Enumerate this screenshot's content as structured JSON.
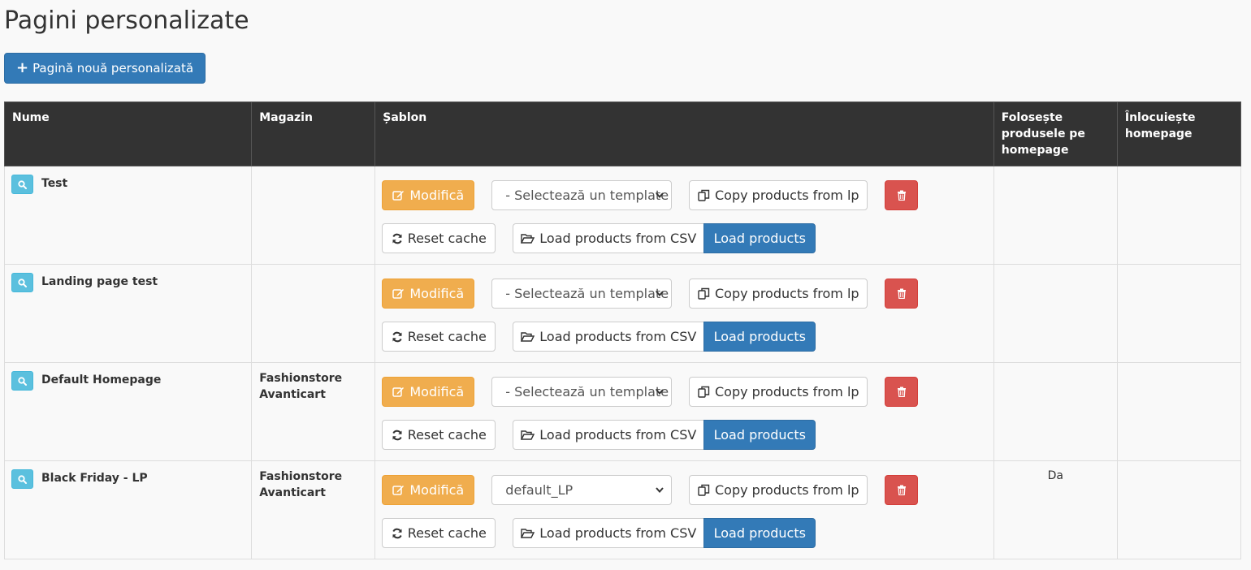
{
  "page": {
    "title": "Pagini personalizate",
    "new_button_label": "Pagină nouă personalizată"
  },
  "colors": {
    "primary": "#337ab7",
    "warning": "#f0ad4e",
    "danger": "#d9534f",
    "info": "#5bc0de",
    "header_bg": "#333333"
  },
  "table": {
    "headers": {
      "name": "Nume",
      "shop": "Magazin",
      "template": "Șablon",
      "use_products": "Folosește produsele pe homepage",
      "replace_homepage": "Înlocuiește homepage"
    },
    "actions": {
      "edit": "Modifică",
      "copy": "Copy products from lp",
      "reset": "Reset cache",
      "csv": "Load products from CSV",
      "load": "Load products"
    },
    "rows": [
      {
        "name": "Test",
        "shop": "",
        "template": "- Selectează un template -",
        "use_products": "",
        "replace_homepage": ""
      },
      {
        "name": "Landing page test",
        "shop": "",
        "template": "- Selectează un template -",
        "use_products": "",
        "replace_homepage": ""
      },
      {
        "name": "Default Homepage",
        "shop": "Fashionstore Avanticart",
        "template": "- Selectează un template -",
        "use_products": "",
        "replace_homepage": ""
      },
      {
        "name": "Black Friday - LP",
        "shop": "Fashionstore Avanticart",
        "template": "default_LP",
        "use_products": "Da",
        "replace_homepage": ""
      }
    ]
  }
}
